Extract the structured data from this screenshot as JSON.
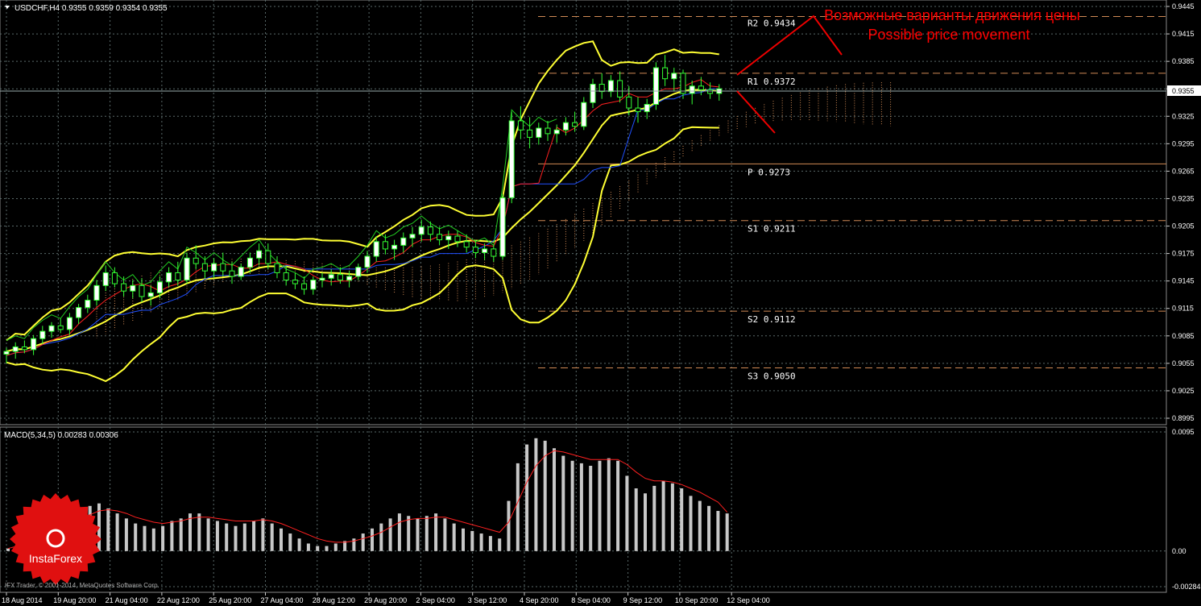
{
  "header": {
    "symbol_line": "USDCHF,H4  0.9355 0.9359 0.9354 0.9355"
  },
  "annotation": {
    "line_ru": "Возможные варианты движения цены",
    "line_en": "Possible price movement",
    "color": "#ff0000"
  },
  "colors": {
    "background": "#000000",
    "grid": "#5a6a6a",
    "bollinger": "#ffff33",
    "tenkan": "#ff2020",
    "kijun": "#2050ff",
    "chikou": "#22cc22",
    "cloud": "#d08a55",
    "bull_candle": "#ffffff",
    "bear_candle": "#000000",
    "candle_wick": "#33ff33",
    "pivot_line": "#d08a55",
    "macd_hist": "#c8c8c8",
    "macd_signal": "#ff2020",
    "text": "#ffffff"
  },
  "price_axis": {
    "ticks": [
      "0.9445",
      "0.9415",
      "0.9385",
      "0.9355",
      "0.9325",
      "0.9295",
      "0.9265",
      "0.9235",
      "0.9205",
      "0.9175",
      "0.9145",
      "0.9115",
      "0.9085",
      "0.9055",
      "0.9025",
      "0.8995"
    ],
    "current_price_label": "0.9355"
  },
  "macd_axis": {
    "ticks": [
      "0.0095",
      "0.00",
      "-0.00284"
    ]
  },
  "time_axis": {
    "labels": [
      "18 Aug 2014",
      "19 Aug 20:00",
      "21 Aug 04:00",
      "22 Aug 12:00",
      "25 Aug 20:00",
      "27 Aug 04:00",
      "28 Aug 12:00",
      "29 Aug 20:00",
      "2 Sep 04:00",
      "3 Sep 12:00",
      "4 Sep 20:00",
      "8 Sep 04:00",
      "9 Sep 12:00",
      "10 Sep 20:00",
      "12 Sep 04:00"
    ]
  },
  "pivot_levels": [
    {
      "label": "R2",
      "value": "0.9434"
    },
    {
      "label": "R1",
      "value": "0.9372"
    },
    {
      "label": "P",
      "value": "0.9273"
    },
    {
      "label": "S1",
      "value": "0.9211"
    },
    {
      "label": "S2",
      "value": "0.9112"
    },
    {
      "label": "S3",
      "value": "0.9050"
    }
  ],
  "macd_panel": {
    "title": "MACD(5,34,5) 0.00283 0.00306"
  },
  "footer": {
    "copyright": "IFX Trader, © 2001-2014, MetaQuotes Software Corp."
  },
  "logo": {
    "text": "InstaForex"
  },
  "chart_data": {
    "type": "candlestick",
    "symbol": "USDCHF",
    "timeframe": "H4",
    "price_ylim": [
      0.8995,
      0.9445
    ],
    "macd_ylim": [
      -0.00284,
      0.0095
    ],
    "last_price": 0.9355,
    "candles": [
      [
        0.9065,
        0.9072,
        0.9055,
        0.9068
      ],
      [
        0.9068,
        0.9078,
        0.906,
        0.9073
      ],
      [
        0.9073,
        0.908,
        0.9066,
        0.907
      ],
      [
        0.907,
        0.9086,
        0.9064,
        0.9082
      ],
      [
        0.9082,
        0.9096,
        0.9076,
        0.909
      ],
      [
        0.909,
        0.91,
        0.9083,
        0.9096
      ],
      [
        0.9096,
        0.9104,
        0.9088,
        0.9092
      ],
      [
        0.9092,
        0.911,
        0.9086,
        0.9105
      ],
      [
        0.9105,
        0.912,
        0.9098,
        0.9116
      ],
      [
        0.9116,
        0.913,
        0.911,
        0.9124
      ],
      [
        0.9124,
        0.9146,
        0.9118,
        0.914
      ],
      [
        0.914,
        0.9162,
        0.9134,
        0.9154
      ],
      [
        0.9154,
        0.916,
        0.9138,
        0.9142
      ],
      [
        0.9142,
        0.915,
        0.9128,
        0.9134
      ],
      [
        0.9134,
        0.9146,
        0.9126,
        0.914
      ],
      [
        0.914,
        0.9148,
        0.9122,
        0.9128
      ],
      [
        0.9128,
        0.914,
        0.9118,
        0.9132
      ],
      [
        0.9132,
        0.915,
        0.9126,
        0.9144
      ],
      [
        0.9144,
        0.916,
        0.9138,
        0.9154
      ],
      [
        0.9154,
        0.9166,
        0.914,
        0.9146
      ],
      [
        0.9146,
        0.9176,
        0.9142,
        0.917
      ],
      [
        0.917,
        0.9184,
        0.9158,
        0.9164
      ],
      [
        0.9164,
        0.9172,
        0.9148,
        0.9156
      ],
      [
        0.9156,
        0.917,
        0.9148,
        0.9164
      ],
      [
        0.9164,
        0.9176,
        0.915,
        0.9156
      ],
      [
        0.9156,
        0.9166,
        0.9142,
        0.915
      ],
      [
        0.915,
        0.9164,
        0.9146,
        0.916
      ],
      [
        0.916,
        0.9176,
        0.9154,
        0.917
      ],
      [
        0.917,
        0.9186,
        0.9162,
        0.9178
      ],
      [
        0.9178,
        0.9186,
        0.9158,
        0.9164
      ],
      [
        0.9164,
        0.9172,
        0.9148,
        0.9154
      ],
      [
        0.9154,
        0.9162,
        0.914,
        0.9146
      ],
      [
        0.9146,
        0.9154,
        0.9136,
        0.9142
      ],
      [
        0.9142,
        0.915,
        0.913,
        0.9136
      ],
      [
        0.9136,
        0.915,
        0.913,
        0.9146
      ],
      [
        0.9146,
        0.9154,
        0.9138,
        0.9148
      ],
      [
        0.9148,
        0.9158,
        0.914,
        0.9152
      ],
      [
        0.9152,
        0.916,
        0.9142,
        0.9146
      ],
      [
        0.9146,
        0.9156,
        0.9138,
        0.915
      ],
      [
        0.915,
        0.9164,
        0.9146,
        0.916
      ],
      [
        0.916,
        0.9178,
        0.9154,
        0.9172
      ],
      [
        0.9172,
        0.9194,
        0.9166,
        0.9188
      ],
      [
        0.9188,
        0.9196,
        0.9174,
        0.918
      ],
      [
        0.918,
        0.919,
        0.9168,
        0.9184
      ],
      [
        0.9184,
        0.9198,
        0.9176,
        0.9192
      ],
      [
        0.9192,
        0.9204,
        0.9182,
        0.9196
      ],
      [
        0.9196,
        0.9212,
        0.9188,
        0.9204
      ],
      [
        0.9204,
        0.921,
        0.9188,
        0.9196
      ],
      [
        0.9196,
        0.9204,
        0.9184,
        0.919
      ],
      [
        0.919,
        0.92,
        0.918,
        0.9194
      ],
      [
        0.9194,
        0.92,
        0.9182,
        0.9188
      ],
      [
        0.9188,
        0.9196,
        0.9176,
        0.9182
      ],
      [
        0.9182,
        0.919,
        0.917,
        0.9176
      ],
      [
        0.9176,
        0.9186,
        0.9168,
        0.918
      ],
      [
        0.918,
        0.9184,
        0.9166,
        0.9172
      ],
      [
        0.9172,
        0.924,
        0.9168,
        0.9236
      ],
      [
        0.9236,
        0.933,
        0.923,
        0.932
      ],
      [
        0.932,
        0.9336,
        0.93,
        0.931
      ],
      [
        0.931,
        0.9324,
        0.929,
        0.9302
      ],
      [
        0.9302,
        0.9318,
        0.9294,
        0.9312
      ],
      [
        0.9312,
        0.932,
        0.9298,
        0.9306
      ],
      [
        0.9306,
        0.9316,
        0.9296,
        0.931
      ],
      [
        0.931,
        0.9324,
        0.9304,
        0.9318
      ],
      [
        0.9318,
        0.933,
        0.9308,
        0.9314
      ],
      [
        0.9314,
        0.9346,
        0.931,
        0.934
      ],
      [
        0.934,
        0.9366,
        0.9334,
        0.936
      ],
      [
        0.936,
        0.9372,
        0.9344,
        0.9352
      ],
      [
        0.9352,
        0.937,
        0.9346,
        0.9364
      ],
      [
        0.9364,
        0.9374,
        0.934,
        0.9346
      ],
      [
        0.9346,
        0.9358,
        0.9326,
        0.9334
      ],
      [
        0.9334,
        0.9346,
        0.9318,
        0.933
      ],
      [
        0.933,
        0.9344,
        0.9322,
        0.9338
      ],
      [
        0.9338,
        0.9384,
        0.9332,
        0.9378
      ],
      [
        0.9378,
        0.9392,
        0.9358,
        0.9366
      ],
      [
        0.9366,
        0.9378,
        0.9352,
        0.9372
      ],
      [
        0.9372,
        0.9376,
        0.9344,
        0.935
      ],
      [
        0.935,
        0.9364,
        0.9338,
        0.9358
      ],
      [
        0.9358,
        0.9368,
        0.9348,
        0.9354
      ],
      [
        0.9354,
        0.9362,
        0.9344,
        0.935
      ],
      [
        0.935,
        0.936,
        0.9342,
        0.9355
      ]
    ],
    "macd_histogram": [
      0.0002,
      0.0006,
      0.001,
      0.0014,
      0.0018,
      0.0022,
      0.0026,
      0.003,
      0.0034,
      0.0036,
      0.0038,
      0.0034,
      0.003,
      0.0026,
      0.0022,
      0.002,
      0.0018,
      0.002,
      0.0024,
      0.0026,
      0.003,
      0.003,
      0.0026,
      0.0024,
      0.0022,
      0.002,
      0.0022,
      0.0024,
      0.0026,
      0.0022,
      0.0018,
      0.0014,
      0.001,
      0.0006,
      0.0004,
      0.0004,
      0.0006,
      0.0008,
      0.001,
      0.0014,
      0.0018,
      0.0022,
      0.0026,
      0.003,
      0.0028,
      0.0026,
      0.0028,
      0.003,
      0.0026,
      0.0022,
      0.0018,
      0.0016,
      0.0014,
      0.0012,
      0.001,
      0.004,
      0.007,
      0.0085,
      0.009,
      0.0088,
      0.0082,
      0.0076,
      0.0072,
      0.007,
      0.0068,
      0.0072,
      0.0074,
      0.0072,
      0.006,
      0.005,
      0.0046,
      0.0052,
      0.0056,
      0.0054,
      0.005,
      0.0044,
      0.004,
      0.0036,
      0.0032,
      0.003
    ],
    "macd_signal": [
      0.0002,
      0.0004,
      0.0007,
      0.001,
      0.0013,
      0.0016,
      0.0019,
      0.0022,
      0.0026,
      0.0029,
      0.0032,
      0.0033,
      0.0032,
      0.003,
      0.0027,
      0.0025,
      0.0023,
      0.0022,
      0.0023,
      0.0024,
      0.0026,
      0.0027,
      0.0027,
      0.0026,
      0.0025,
      0.0024,
      0.0024,
      0.0024,
      0.0025,
      0.0024,
      0.0022,
      0.0019,
      0.0016,
      0.0013,
      0.001,
      0.0008,
      0.0007,
      0.0007,
      0.0008,
      0.001,
      0.0012,
      0.0015,
      0.0019,
      0.0023,
      0.0025,
      0.0026,
      0.0026,
      0.0027,
      0.0027,
      0.0025,
      0.0023,
      0.0021,
      0.0019,
      0.0017,
      0.0015,
      0.0023,
      0.0039,
      0.0055,
      0.0068,
      0.0076,
      0.008,
      0.0079,
      0.0077,
      0.0075,
      0.0073,
      0.0073,
      0.0073,
      0.0073,
      0.0069,
      0.0063,
      0.0058,
      0.0056,
      0.0056,
      0.0055,
      0.0053,
      0.005,
      0.0047,
      0.0043,
      0.0039,
      0.0031
    ]
  }
}
